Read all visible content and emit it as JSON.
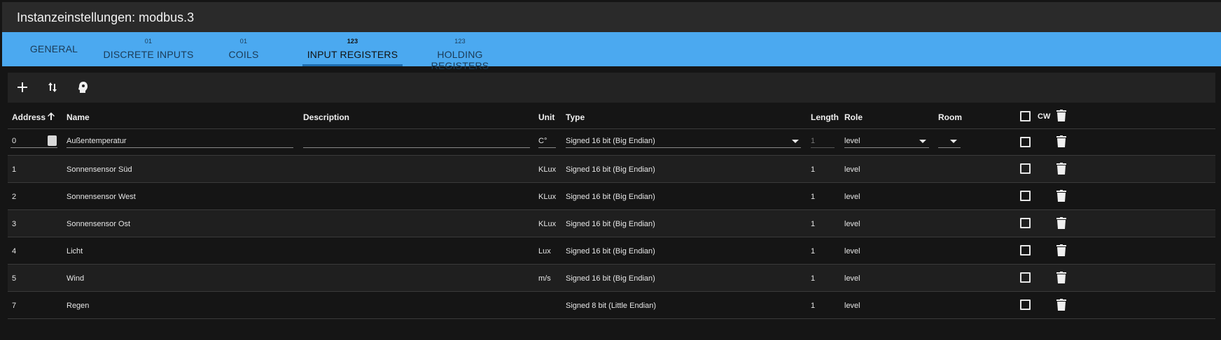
{
  "window": {
    "title": "Instanzeinstellungen: modbus.3"
  },
  "tabs": [
    {
      "label": "GENERAL",
      "sup": ""
    },
    {
      "label": "DISCRETE INPUTS",
      "sup": "01"
    },
    {
      "label": "COILS",
      "sup": "01"
    },
    {
      "label": "INPUT REGISTERS",
      "sup": "123",
      "active": true
    },
    {
      "label": "HOLDING REGISTERS",
      "sup": "123"
    }
  ],
  "toolbar": {
    "icons": [
      "add-icon",
      "sort-icon",
      "import-icon"
    ]
  },
  "columns": {
    "address": "Address",
    "name": "Name",
    "description": "Description",
    "unit": "Unit",
    "type": "Type",
    "length": "Length",
    "role": "Role",
    "room": "Room",
    "cw": "CW"
  },
  "rows": [
    {
      "address": "0",
      "name": "Außentemperatur",
      "description": "",
      "unit": "C°",
      "type": "Signed 16 bit (Big Endian)",
      "length": "1",
      "role": "level",
      "room": ""
    },
    {
      "address": "1",
      "name": "Sonnensensor Süd",
      "description": "",
      "unit": "KLux",
      "type": "Signed 16 bit (Big Endian)",
      "length": "1",
      "role": "level",
      "room": ""
    },
    {
      "address": "2",
      "name": "Sonnensensor West",
      "description": "",
      "unit": "KLux",
      "type": "Signed 16 bit (Big Endian)",
      "length": "1",
      "role": "level",
      "room": ""
    },
    {
      "address": "3",
      "name": "Sonnensensor Ost",
      "description": "",
      "unit": "KLux",
      "type": "Signed 16 bit (Big Endian)",
      "length": "1",
      "role": "level",
      "room": ""
    },
    {
      "address": "4",
      "name": "Licht",
      "description": "",
      "unit": "Lux",
      "type": "Signed 16 bit (Big Endian)",
      "length": "1",
      "role": "level",
      "room": ""
    },
    {
      "address": "5",
      "name": "Wind",
      "description": "",
      "unit": "m/s",
      "type": "Signed 16 bit (Big Endian)",
      "length": "1",
      "role": "level",
      "room": ""
    },
    {
      "address": "7",
      "name": "Regen",
      "description": "",
      "unit": "",
      "type": "Signed 8 bit (Little Endian)",
      "length": "1",
      "role": "level",
      "room": ""
    }
  ],
  "colors": {
    "tab_bar": "#4ba9f0",
    "background": "#151515",
    "titlebar": "#2a2a2a"
  }
}
